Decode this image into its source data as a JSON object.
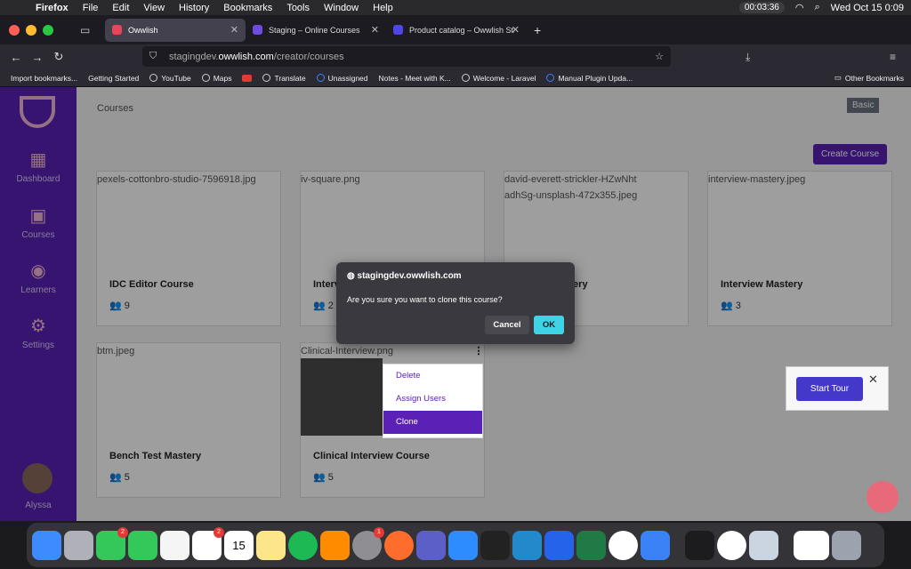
{
  "menubar": {
    "app": "Firefox",
    "items": [
      "File",
      "Edit",
      "View",
      "History",
      "Bookmarks",
      "Tools",
      "Window",
      "Help"
    ],
    "timer": "00:03:36",
    "datetime": "Wed Oct 15  0:09"
  },
  "tabs": [
    {
      "label": "Owwlish",
      "active": true
    },
    {
      "label": "Staging – Online Courses",
      "active": false
    },
    {
      "label": "Product catalog – Owwlish Stag",
      "active": false
    }
  ],
  "url": {
    "prefix": "stagingdev.",
    "domain": "owwlish.com",
    "path": "/creator/courses"
  },
  "bookmarks": [
    "Import bookmarks...",
    "Getting Started",
    "YouTube",
    "Maps",
    "Translate",
    "Unassigned",
    "Notes - Meet with K...",
    "Welcome - Laravel",
    "Manual Plugin Upda..."
  ],
  "other_bookmarks": "Other Bookmarks",
  "sidebar": {
    "items": [
      {
        "label": "Dashboard",
        "icon": "grid-icon"
      },
      {
        "label": "Courses",
        "icon": "presentation-icon"
      },
      {
        "label": "Learners",
        "icon": "user-icon"
      },
      {
        "label": "Settings",
        "icon": "gear-icon"
      }
    ],
    "user": "Alyssa"
  },
  "page": {
    "title": "Courses",
    "badge": "Basic",
    "create_button": "Create Course"
  },
  "courses": [
    {
      "img": "pexels-cottonbro-studio-7596918.jpg",
      "title": "IDC Editor Course",
      "count": "9"
    },
    {
      "img": "iv-square.png",
      "title": "Interview",
      "count": "2"
    },
    {
      "img": "david-everett-strickler-HZwNhtadhSg-unsplash-472x355.jpeg",
      "title": "Mastery",
      "count": ""
    },
    {
      "img": "interview-mastery.jpeg",
      "title": "Interview Mastery",
      "count": "3"
    },
    {
      "img": "btm.jpeg",
      "title": "Bench Test Mastery",
      "count": "5"
    },
    {
      "img": "Clinical-Interview.png",
      "title": "Clinical Interview Course",
      "count": "5"
    }
  ],
  "card_menu": [
    "Delete",
    "Assign Users",
    "Clone"
  ],
  "dialog": {
    "host": "stagingdev.owwlish.com",
    "message": "Are you sure you want to clone this course?",
    "cancel": "Cancel",
    "ok": "OK"
  },
  "tour": {
    "button": "Start Tour"
  },
  "dock": {
    "badges": {
      "facetime": "2",
      "slack": "2",
      "settings": "1"
    },
    "calendar_month": "OCT",
    "calendar_day": "15"
  }
}
